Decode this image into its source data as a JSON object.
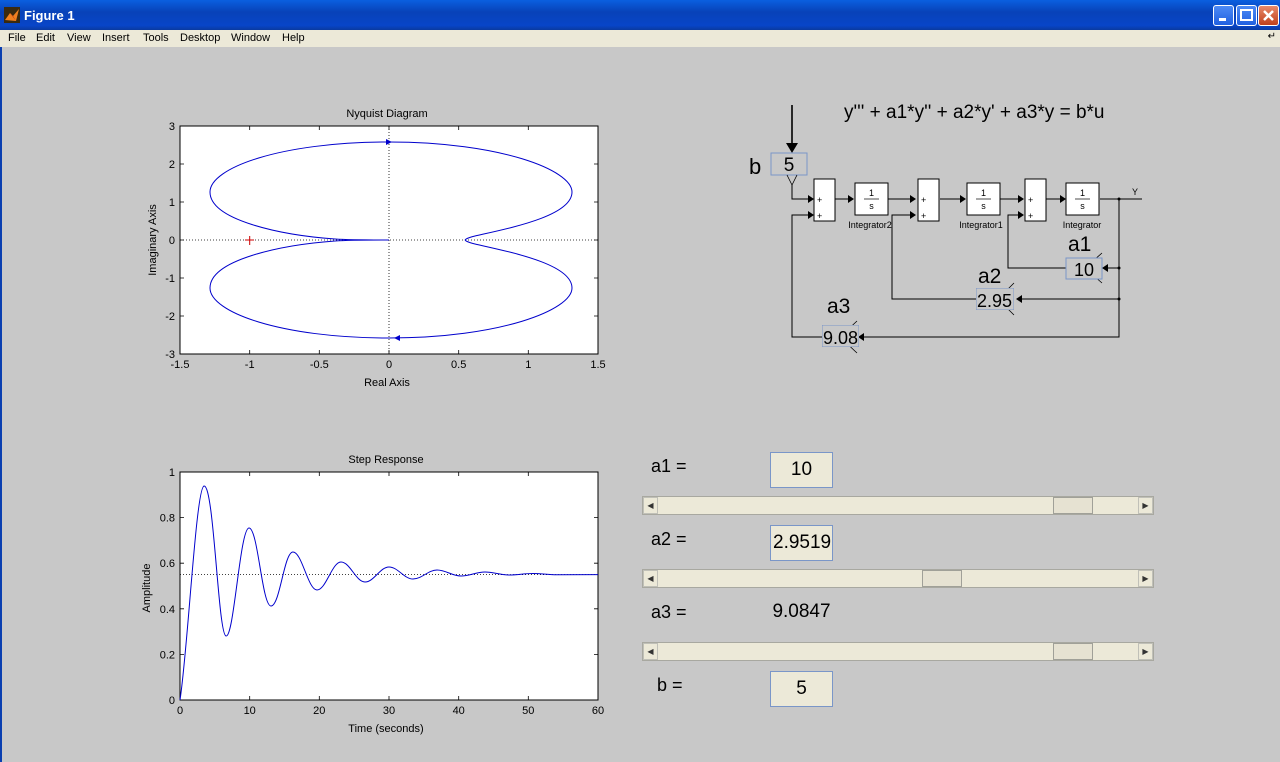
{
  "window": {
    "title": "Figure 1",
    "controls": [
      "minimize",
      "maximize",
      "close"
    ]
  },
  "menu": [
    "File",
    "Edit",
    "View",
    "Insert",
    "Tools",
    "Desktop",
    "Window",
    "Help"
  ],
  "nyquist": {
    "title": "Nyquist Diagram",
    "xlabel": "Real Axis",
    "ylabel": "Imaginary Axis",
    "xticks": [
      "-1.5",
      "-1",
      "-0.5",
      "0",
      "0.5",
      "1",
      "1.5"
    ],
    "yticks": [
      "3",
      "2",
      "1",
      "0",
      "-1",
      "-2",
      "-3"
    ]
  },
  "step": {
    "title": "Step Response",
    "xlabel": "Time (seconds)",
    "ylabel": "Amplitude",
    "xticks": [
      "0",
      "10",
      "20",
      "30",
      "40",
      "50",
      "60"
    ],
    "yticks": [
      "1",
      "0.8",
      "0.6",
      "0.4",
      "0.2",
      "0"
    ]
  },
  "diagram": {
    "equation": "y''' + a1*y'' + a2*y' + a3*y = b*u",
    "gain_b": {
      "symbol": "b",
      "value": "5"
    },
    "gain_a1": {
      "symbol": "a1",
      "value": "10"
    },
    "gain_a2": {
      "symbol": "a2",
      "value": "2.95"
    },
    "gain_a3": {
      "symbol": "a3",
      "value": "9.08"
    },
    "integrator_names": [
      "Integrator2",
      "Integrator1",
      "Integrator"
    ],
    "integrator_symbol": {
      "num": "1",
      "den": "s"
    },
    "output": "Y",
    "plus": "+"
  },
  "controls": {
    "a1": {
      "label": "a1 =",
      "value": "10",
      "slider_fraction": 0.9
    },
    "a2": {
      "label": "a2 =",
      "value": "2.9519",
      "slider_fraction": 0.6
    },
    "a3": {
      "label": "a3 =",
      "value": "9.0847",
      "slider_fraction": 0.9
    },
    "b": {
      "label": "b =",
      "value": "5"
    }
  },
  "chart_data": [
    {
      "type": "line",
      "title": "Nyquist Diagram",
      "xlabel": "Real Axis",
      "ylabel": "Imaginary Axis",
      "xlim": [
        -1.5,
        1.5
      ],
      "ylim": [
        -3,
        3
      ],
      "series": [
        {
          "x": [
            0,
            0.6,
            1.1,
            1.32,
            1.1,
            0.6,
            0.55,
            0.4,
            -0.3,
            -0.6,
            -1.0,
            -1.29,
            -1.1,
            -0.6,
            0
          ],
          "y": [
            2.58,
            2.45,
            1.9,
            1.28,
            0.65,
            0.1,
            0,
            0,
            0,
            0.1,
            0.45,
            1.28,
            2.1,
            2.5,
            2.58
          ]
        }
      ],
      "markers": [
        {
          "x": -1,
          "y": 0,
          "symbol": "+"
        }
      ],
      "grid": false
    },
    {
      "type": "line",
      "title": "Step Response",
      "xlabel": "Time (seconds)",
      "ylabel": "Amplitude",
      "xlim": [
        0,
        60
      ],
      "ylim": [
        0,
        1
      ],
      "steady_state": 0.55,
      "series": [
        {
          "x": [
            0,
            1,
            2,
            3.5,
            5,
            6.8,
            8.5,
            10,
            11.5,
            13,
            14.5,
            16.5,
            18.5,
            20,
            23,
            26,
            30,
            35,
            40,
            50,
            60
          ],
          "y": [
            0,
            0.3,
            0.75,
            0.94,
            0.65,
            0.27,
            0.55,
            0.75,
            0.6,
            0.4,
            0.55,
            0.65,
            0.55,
            0.48,
            0.6,
            0.52,
            0.57,
            0.53,
            0.56,
            0.55,
            0.55
          ]
        }
      ],
      "grid": false
    }
  ]
}
